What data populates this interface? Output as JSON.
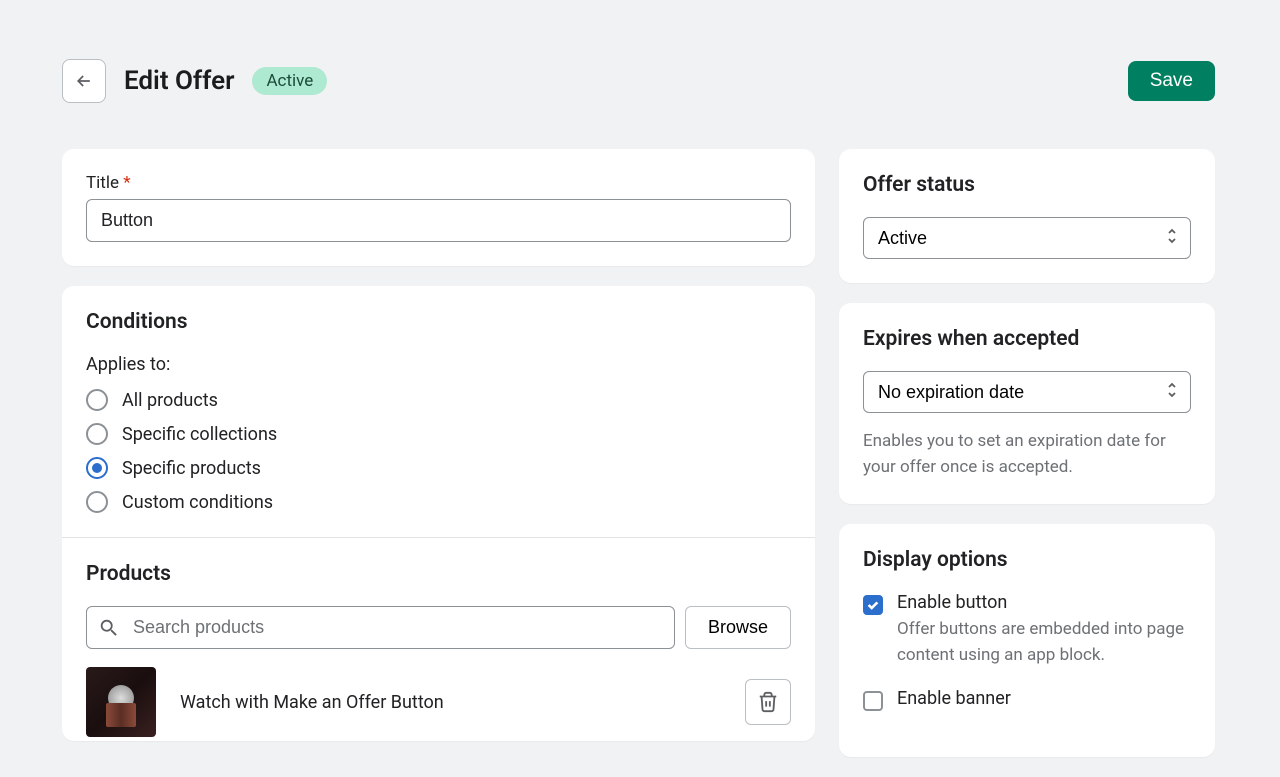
{
  "header": {
    "title": "Edit Offer",
    "badge": "Active",
    "save_label": "Save"
  },
  "title_card": {
    "label": "Title",
    "value": "Button"
  },
  "conditions": {
    "heading": "Conditions",
    "applies_label": "Applies to:",
    "options": [
      {
        "label": "All products",
        "checked": false
      },
      {
        "label": "Specific collections",
        "checked": false
      },
      {
        "label": "Specific products",
        "checked": true
      },
      {
        "label": "Custom conditions",
        "checked": false
      }
    ]
  },
  "products": {
    "heading": "Products",
    "search_placeholder": "Search products",
    "browse_label": "Browse",
    "items": [
      {
        "name": "Watch with Make an Offer Button"
      }
    ]
  },
  "status": {
    "heading": "Offer status",
    "value": "Active"
  },
  "expiration": {
    "heading": "Expires when accepted",
    "value": "No expiration date",
    "help": "Enables you to set an expiration date for your offer once is accepted."
  },
  "display": {
    "heading": "Display options",
    "options": [
      {
        "label": "Enable button",
        "desc": "Offer buttons are embedded into page content using an app block.",
        "checked": true
      },
      {
        "label": "Enable banner",
        "desc": "",
        "checked": false
      }
    ]
  }
}
